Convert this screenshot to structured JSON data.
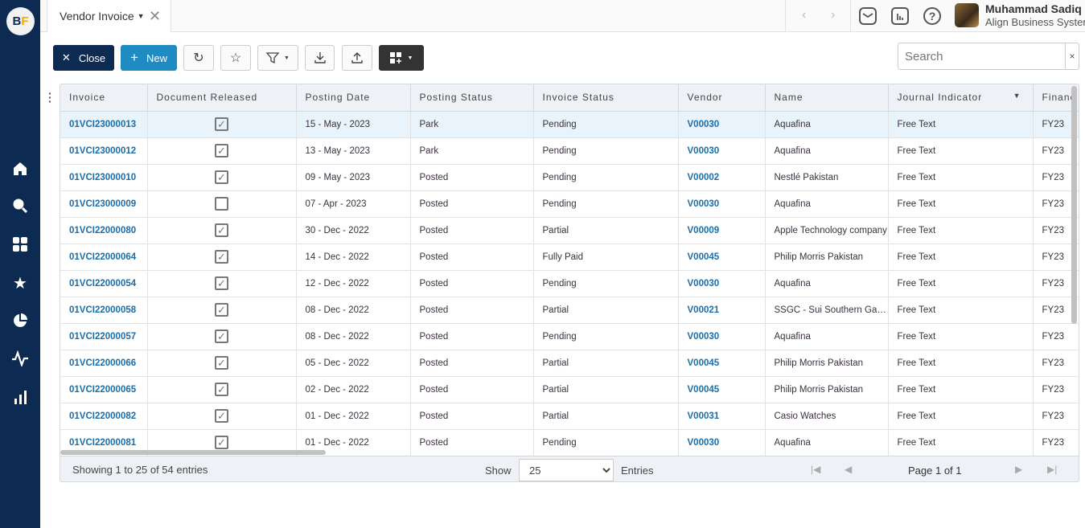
{
  "sidebar": {
    "logo": "BF",
    "items": [
      {
        "icon": "home-icon"
      },
      {
        "icon": "search-icon"
      },
      {
        "icon": "apps-icon"
      },
      {
        "icon": "star-icon"
      },
      {
        "icon": "pie-chart-icon"
      },
      {
        "icon": "activity-icon"
      },
      {
        "icon": "bar-chart-icon"
      }
    ]
  },
  "tab": {
    "label": "Vendor Invoice"
  },
  "user": {
    "name": "Muhammad Sadiq",
    "org": "Align Business Systems"
  },
  "toolbar": {
    "close": "Close",
    "new": "New"
  },
  "search": {
    "placeholder": "Search",
    "clear": "×"
  },
  "table": {
    "columns": [
      "Invoice",
      "Document Released",
      "Posting Date",
      "Posting Status",
      "Invoice Status",
      "Vendor",
      "Name",
      "Journal Indicator",
      "Financ"
    ],
    "rows": [
      [
        "01VCI23000013",
        true,
        "15 - May - 2023",
        "Park",
        "Pending",
        "V00030",
        "Aquafina",
        "Free Text",
        "FY23"
      ],
      [
        "01VCI23000012",
        true,
        "13 - May - 2023",
        "Park",
        "Pending",
        "V00030",
        "Aquafina",
        "Free Text",
        "FY23"
      ],
      [
        "01VCI23000010",
        true,
        "09 - May - 2023",
        "Posted",
        "Pending",
        "V00002",
        "Nestlé Pakistan",
        "Free Text",
        "FY23"
      ],
      [
        "01VCI23000009",
        false,
        "07 - Apr - 2023",
        "Posted",
        "Pending",
        "V00030",
        "Aquafina",
        "Free Text",
        "FY23"
      ],
      [
        "01VCI22000080",
        true,
        "30 - Dec - 2022",
        "Posted",
        "Partial",
        "V00009",
        "Apple Technology company",
        "Free Text",
        "FY23"
      ],
      [
        "01VCI22000064",
        true,
        "14 - Dec - 2022",
        "Posted",
        "Fully Paid",
        "V00045",
        "Philip Morris Pakistan",
        "Free Text",
        "FY23"
      ],
      [
        "01VCI22000054",
        true,
        "12 - Dec - 2022",
        "Posted",
        "Pending",
        "V00030",
        "Aquafina",
        "Free Text",
        "FY23"
      ],
      [
        "01VCI22000058",
        true,
        "08 - Dec - 2022",
        "Posted",
        "Partial",
        "V00021",
        "SSGC - Sui Southern Gas Company",
        "Free Text",
        "FY23"
      ],
      [
        "01VCI22000057",
        true,
        "08 - Dec - 2022",
        "Posted",
        "Pending",
        "V00030",
        "Aquafina",
        "Free Text",
        "FY23"
      ],
      [
        "01VCI22000066",
        true,
        "05 - Dec - 2022",
        "Posted",
        "Partial",
        "V00045",
        "Philip Morris Pakistan",
        "Free Text",
        "FY23"
      ],
      [
        "01VCI22000065",
        true,
        "02 - Dec - 2022",
        "Posted",
        "Partial",
        "V00045",
        "Philip Morris Pakistan",
        "Free Text",
        "FY23"
      ],
      [
        "01VCI22000082",
        true,
        "01 - Dec - 2022",
        "Posted",
        "Partial",
        "V00031",
        "Casio Watches",
        "Free Text",
        "FY23"
      ],
      [
        "01VCI22000081",
        true,
        "01 - Dec - 2022",
        "Posted",
        "Pending",
        "V00030",
        "Aquafina",
        "Free Text",
        "FY23"
      ]
    ]
  },
  "footer": {
    "info": "Showing 1 to 25 of 54 entries",
    "show": "Show",
    "page_size": "25",
    "entries": "Entries",
    "page": "Page 1 of 1"
  }
}
